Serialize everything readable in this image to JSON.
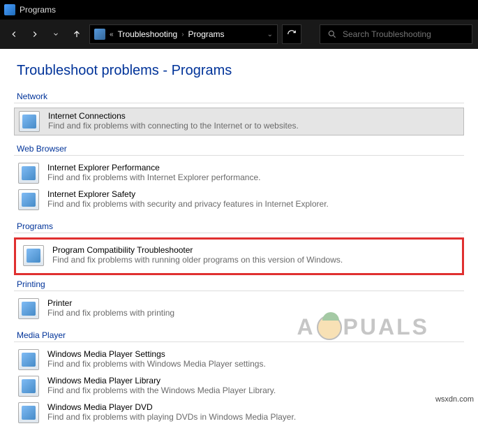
{
  "window": {
    "title": "Programs"
  },
  "breadcrumb": {
    "seg1": "Troubleshooting",
    "seg2": "Programs"
  },
  "search": {
    "placeholder": "Search Troubleshooting"
  },
  "page_title": "Troubleshoot problems - Programs",
  "sections": {
    "network": {
      "label": "Network",
      "items": [
        {
          "name": "Internet Connections",
          "desc": "Find and fix problems with connecting to the Internet or to websites."
        }
      ]
    },
    "web_browser": {
      "label": "Web Browser",
      "items": [
        {
          "name": "Internet Explorer Performance",
          "desc": "Find and fix problems with Internet Explorer performance."
        },
        {
          "name": "Internet Explorer Safety",
          "desc": "Find and fix problems with security and privacy features in Internet Explorer."
        }
      ]
    },
    "programs": {
      "label": "Programs",
      "items": [
        {
          "name": "Program Compatibility Troubleshooter",
          "desc": "Find and fix problems with running older programs on this version of Windows."
        }
      ]
    },
    "printing": {
      "label": "Printing",
      "items": [
        {
          "name": "Printer",
          "desc": "Find and fix problems with printing"
        }
      ]
    },
    "media_player": {
      "label": "Media Player",
      "items": [
        {
          "name": "Windows Media Player Settings",
          "desc": "Find and fix problems with Windows Media Player settings."
        },
        {
          "name": "Windows Media Player Library",
          "desc": "Find and fix problems with the Windows Media Player Library."
        },
        {
          "name": "Windows Media Player DVD",
          "desc": "Find and fix problems with playing DVDs in Windows Media Player."
        }
      ]
    }
  },
  "watermark": {
    "left": "A",
    "right": "PUALS"
  },
  "site": "wsxdn.com"
}
